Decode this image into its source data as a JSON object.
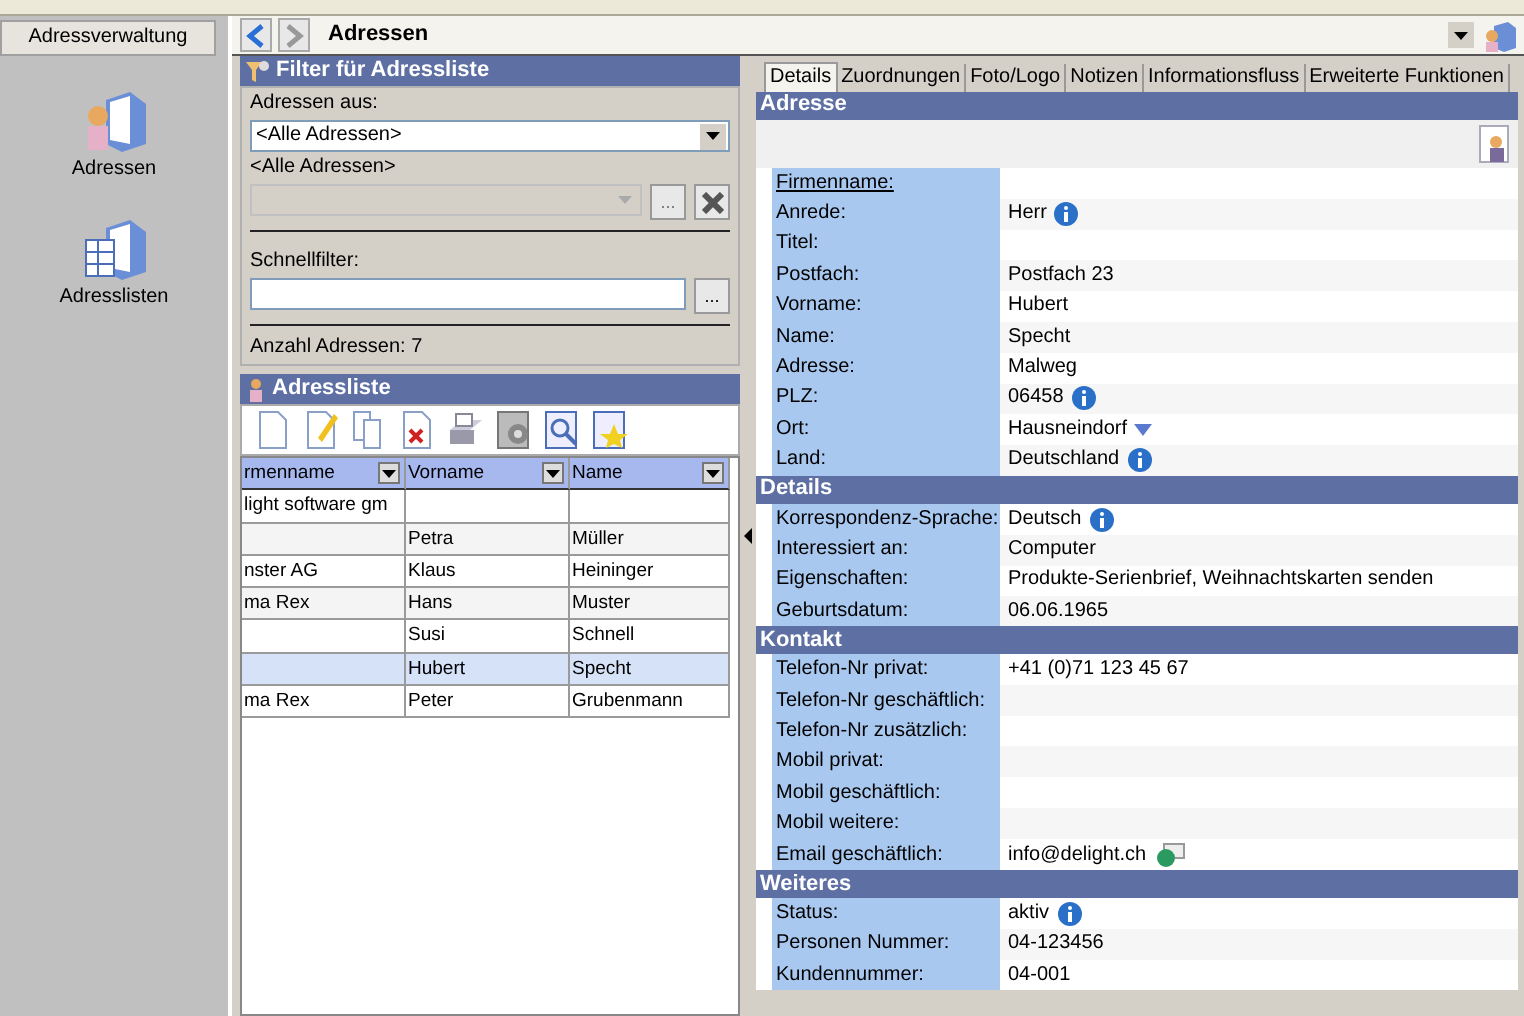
{
  "sidebar": {
    "title": "Adressverwaltung",
    "items": [
      {
        "label": "Adressen",
        "selected": false
      },
      {
        "label": "Adresslisten",
        "selected": false
      }
    ]
  },
  "nav": {
    "title": "Adressen"
  },
  "filter": {
    "title": "Filter für Adressliste",
    "source_label": "Adressen aus:",
    "source_value": "<Alle Adressen>",
    "sub_label": "<Alle Adressen>",
    "quick_label": "Schnellfilter:",
    "browse_label": "...",
    "sub_browse_label": "...",
    "count": "Anzahl Adressen: 7"
  },
  "list": {
    "title": "Adressliste",
    "columns": [
      "rmenname",
      "Vorname",
      "Name"
    ],
    "rows": [
      {
        "cells": [
          "light software gm",
          "",
          ""
        ],
        "selected": false
      },
      {
        "cells": [
          "",
          "Petra",
          "Müller"
        ],
        "selected": false
      },
      {
        "cells": [
          "nster AG",
          "Klaus",
          "Heininger"
        ],
        "selected": false
      },
      {
        "cells": [
          "ma Rex",
          "Hans",
          "Muster"
        ],
        "selected": false
      },
      {
        "cells": [
          "",
          "Susi",
          "Schnell"
        ],
        "selected": false
      },
      {
        "cells": [
          "",
          "Hubert",
          "Specht"
        ],
        "selected": true
      },
      {
        "cells": [
          "ma Rex",
          "Peter",
          "Grubenmann"
        ],
        "selected": false
      }
    ]
  },
  "detail_tabs": [
    {
      "label": "Details",
      "selected": true
    },
    {
      "label": "Zuordnungen",
      "selected": false
    },
    {
      "label": "Foto/Logo",
      "selected": false
    },
    {
      "label": "Notizen",
      "selected": false
    },
    {
      "label": "Informationsfluss",
      "selected": false
    },
    {
      "label": "Erweiterte Funktionen",
      "selected": false
    }
  ],
  "sections": [
    {
      "title": "Adresse",
      "has_photo": true,
      "fields": [
        {
          "label": "Firmenname:",
          "underlined": true
        },
        {
          "label": "Anrede:",
          "value": "Herr",
          "kind": "info"
        },
        {
          "label": "Titel:"
        },
        {
          "label": "Postfach:",
          "value": "Postfach 23"
        },
        {
          "label": "Vorname:",
          "value": "Hubert"
        },
        {
          "label": "Name:",
          "value": "Specht"
        },
        {
          "label": "Adresse:",
          "value": "Malweg"
        },
        {
          "label": "PLZ:",
          "value": "06458",
          "kind": "info"
        },
        {
          "label": "Ort:",
          "value": "Hausneindorf",
          "kind": "dropdown"
        },
        {
          "label": "Land:",
          "value": "Deutschland",
          "kind": "info"
        }
      ]
    },
    {
      "title": "Details",
      "fields": [
        {
          "label": "Korrespondenz-Sprache:",
          "value": "Deutsch",
          "kind": "info"
        },
        {
          "label": "Interessiert an:",
          "value": "Computer"
        },
        {
          "label": "Eigenschaften:",
          "value": "Produkte-Serienbrief, Weihnachtskarten senden"
        },
        {
          "label": "Geburtsdatum:",
          "value": "06.06.1965"
        }
      ]
    },
    {
      "title": "Kontakt",
      "fields": [
        {
          "label": "Telefon-Nr privat:",
          "value": "+41 (0)71 123 45 67"
        },
        {
          "label": "Telefon-Nr geschäftlich:"
        },
        {
          "label": "Telefon-Nr zusätzlich:"
        },
        {
          "label": "Mobil privat:"
        },
        {
          "label": "Mobil geschäftlich:"
        },
        {
          "label": "Mobil weitere:"
        },
        {
          "label": "Email geschäftlich:",
          "value": "info@delight.ch",
          "kind": "email"
        }
      ]
    },
    {
      "title": "Weiteres",
      "fields": [
        {
          "label": "Status:",
          "value": "aktiv",
          "kind": "info"
        },
        {
          "label": "Personen Nummer:",
          "value": "04-123456"
        },
        {
          "label": "Kundennummer:",
          "value": "04-001"
        }
      ]
    }
  ]
}
